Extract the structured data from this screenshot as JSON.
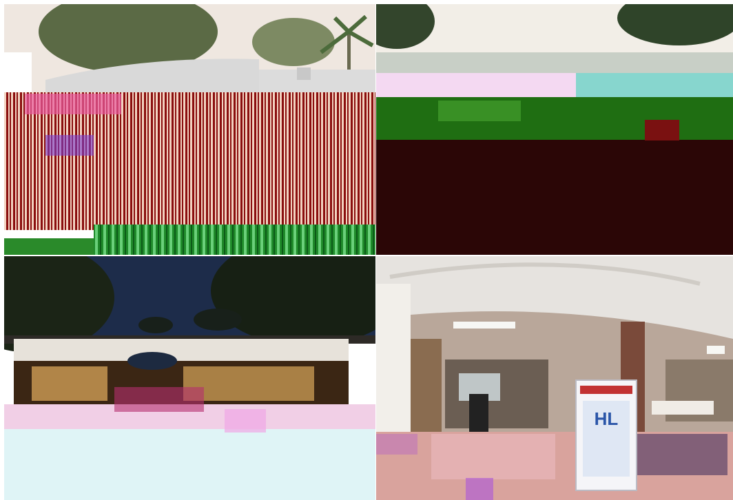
{
  "collage": {
    "tiles": [
      {
        "id": "daytime-exterior"
      },
      {
        "id": "exterior-dusk"
      },
      {
        "id": "evening-exterior"
      },
      {
        "id": "cafeteria-interior"
      }
    ]
  },
  "signs": {
    "fridge_brand": "HL"
  },
  "colors": {
    "sky_day": "#efe7e0",
    "foliage": "#5b6a45",
    "roof": "#d9d9d9",
    "brick_red": "#8a0e0e",
    "green_band": "#2a8a2a",
    "dark_maroon": "#2b0606",
    "night_sky": "#1d2c4a",
    "warm_light": "#d9a65a",
    "ceiling": "#e6e3df",
    "floor_tile": "#d9a39d",
    "fridge_blue": "#2a55a8"
  }
}
